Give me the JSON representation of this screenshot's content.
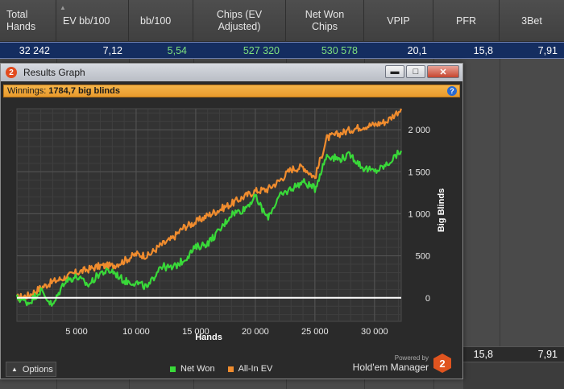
{
  "table": {
    "headers": [
      {
        "label": "Total Hands",
        "align": "left"
      },
      {
        "label": "EV bb/100",
        "align": "left"
      },
      {
        "label": "bb/100",
        "align": "left"
      },
      {
        "label": "Chips (EV Adjusted)",
        "align": "center"
      },
      {
        "label": "Net Won Chips",
        "align": "center"
      },
      {
        "label": "VPIP",
        "align": "center"
      },
      {
        "label": "PFR",
        "align": "center"
      },
      {
        "label": "3Bet",
        "align": "center"
      }
    ],
    "row": [
      "32 242",
      "7,12",
      "5,54",
      "527 320",
      "530 578",
      "20,1",
      "15,8",
      "7,91"
    ],
    "green_cols": [
      2,
      3,
      4
    ],
    "bottom_row": [
      "15,8",
      "7,91"
    ]
  },
  "window": {
    "title": "Results Graph",
    "app_badge": "2",
    "controls": {
      "minimize": "▬",
      "maximize": "□",
      "close": "✕"
    },
    "winnings_label": "Winnings:",
    "winnings_value": "1784,7 big blinds",
    "help": "?",
    "options_label": "Options",
    "powered_by": "Powered by",
    "brand": "Hold'em Manager",
    "brand_badge": "2",
    "legend": [
      {
        "label": "Net Won",
        "color": "#39d939"
      },
      {
        "label": "All-In EV",
        "color": "#f08c2e"
      }
    ]
  },
  "chart_data": {
    "type": "line",
    "xlabel": "Hands",
    "ylabel": "Big Blinds",
    "xlim": [
      0,
      32242
    ],
    "ylim": [
      -280,
      2250
    ],
    "x_ticks": [
      5000,
      10000,
      15000,
      20000,
      25000,
      30000
    ],
    "x_tick_labels": [
      "5 000",
      "10 000",
      "15 000",
      "20 000",
      "25 000",
      "30 000"
    ],
    "y_ticks": [
      0,
      500,
      1000,
      1500,
      2000
    ],
    "y_tick_labels": [
      "0",
      "500",
      "1 000",
      "1 500",
      "2 000"
    ],
    "grid": true,
    "zero_line": true,
    "series": [
      {
        "name": "All-In EV",
        "color": "#f08c2e",
        "x": [
          0,
          1000,
          2000,
          3000,
          4000,
          5000,
          6000,
          7000,
          8000,
          9000,
          10000,
          11000,
          12000,
          13000,
          14000,
          15000,
          16000,
          17000,
          18000,
          19000,
          20000,
          21000,
          22000,
          23000,
          24000,
          25000,
          26000,
          27000,
          28000,
          29000,
          30000,
          31000,
          32242
        ],
        "y": [
          0,
          30,
          120,
          190,
          240,
          300,
          340,
          380,
          380,
          440,
          520,
          500,
          620,
          700,
          840,
          900,
          980,
          1050,
          1120,
          1200,
          1270,
          1290,
          1390,
          1530,
          1560,
          1430,
          1900,
          1950,
          2000,
          2040,
          2060,
          2100,
          2250
        ]
      },
      {
        "name": "Net Won",
        "color": "#39d939",
        "x": [
          0,
          1000,
          2000,
          3000,
          4000,
          5000,
          6000,
          7000,
          8000,
          9000,
          10000,
          11000,
          12000,
          13000,
          14000,
          15000,
          16000,
          17000,
          18000,
          19000,
          20000,
          21000,
          22000,
          23000,
          24000,
          25000,
          26000,
          27000,
          28000,
          29000,
          30000,
          31000,
          32242
        ],
        "y": [
          0,
          -60,
          90,
          -100,
          200,
          250,
          150,
          300,
          320,
          200,
          180,
          120,
          380,
          350,
          450,
          600,
          650,
          800,
          1000,
          1050,
          1200,
          950,
          1200,
          1300,
          1380,
          1300,
          1700,
          1650,
          1700,
          1550,
          1500,
          1580,
          1750
        ]
      }
    ]
  }
}
